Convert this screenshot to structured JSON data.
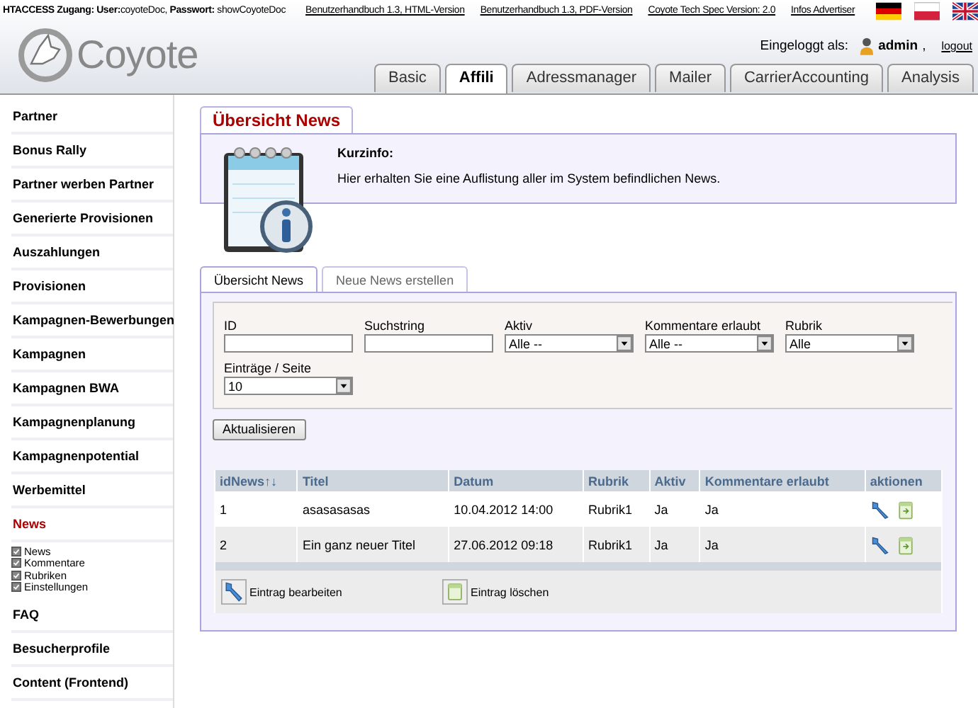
{
  "topbar": {
    "access": "**HTACCESS Zugang: User:**coyoteDoc, **Passwort:** showCoyoteDoc",
    "links": [
      "Benutzerhandbuch 1.3, HTML-Version",
      "Benutzerhandbuch 1.3, PDF-Version",
      "Coyote Tech Spec Version: 2.0",
      "Infos Advertiser"
    ]
  },
  "logo": "Coyote",
  "login": {
    "label": "Eingeloggt als:",
    "user": "admin",
    "separator": ",",
    "logout": "logout"
  },
  "tabs": [
    {
      "label": "Basic",
      "selected": false
    },
    {
      "label": "Affili",
      "selected": true
    },
    {
      "label": "Adressmanager",
      "selected": false
    },
    {
      "label": "Mailer",
      "selected": false
    },
    {
      "label": "CarrierAccounting",
      "selected": false
    },
    {
      "label": "Analysis",
      "selected": false
    }
  ],
  "sidebar": {
    "items": [
      {
        "label": "Partner",
        "selected": false
      },
      {
        "label": "Bonus Rally",
        "selected": false
      },
      {
        "label": "Partner werben Partner",
        "selected": false
      },
      {
        "label": "Generierte Provisionen",
        "selected": false
      },
      {
        "label": "Auszahlungen",
        "selected": false
      },
      {
        "label": "Provisionen",
        "selected": false
      },
      {
        "label": "Kampagnen-Bewerbungen",
        "selected": false
      },
      {
        "label": "Kampagnen",
        "selected": false
      },
      {
        "label": "Kampagnen BWA",
        "selected": false
      },
      {
        "label": "Kampagnenplanung",
        "selected": false
      },
      {
        "label": "Kampagnenpotential",
        "selected": false
      },
      {
        "label": "Werbemittel",
        "selected": false
      },
      {
        "label": "News",
        "selected": true,
        "children": [
          {
            "label": "News"
          },
          {
            "label": "Kommentare"
          },
          {
            "label": "Rubriken"
          },
          {
            "label": "Einstellungen"
          }
        ]
      },
      {
        "label": "FAQ",
        "selected": false
      },
      {
        "label": "Besucherprofile",
        "selected": false
      },
      {
        "label": "Content (Frontend)",
        "selected": false
      }
    ]
  },
  "page_title": "Übersicht News",
  "info": {
    "heading": "Kurzinfo:",
    "text": "Hier erhalten Sie eine Auflistung aller im System befindlichen News."
  },
  "subtabs": [
    {
      "label": "Übersicht News",
      "selected": true
    },
    {
      "label": "Neue News erstellen",
      "selected": false
    }
  ],
  "filters": [
    {
      "kind": "text",
      "label": "ID"
    },
    {
      "kind": "text",
      "label": "Suchstring"
    },
    {
      "kind": "select",
      "label": "Aktiv",
      "value": "Alle --"
    },
    {
      "kind": "select",
      "label": "Kommentare erlaubt",
      "value": "Alle --"
    },
    {
      "kind": "select",
      "label": "Rubrik",
      "value": "Alle"
    },
    {
      "kind": "select",
      "label": "Einträge / Seite",
      "value": "10"
    }
  ],
  "refresh_button": "Aktualisieren",
  "table": {
    "columns": [
      "idNews↑↓",
      "Titel",
      "Datum",
      "Rubrik",
      "Aktiv",
      "Kommentare erlaubt",
      "aktionen"
    ],
    "rows": [
      [
        "1",
        "asasasasas",
        "10.04.2012 14:00",
        "Rubrik1",
        "Ja",
        "Ja"
      ],
      [
        "2",
        "Ein ganz neuer Titel",
        "27.06.2012 09:18",
        "Rubrik1",
        "Ja",
        "Ja"
      ]
    ]
  },
  "legend": [
    {
      "kind": "edit",
      "label": "Eintrag bearbeiten"
    },
    {
      "kind": "delete",
      "label": "Eintrag löschen"
    }
  ]
}
